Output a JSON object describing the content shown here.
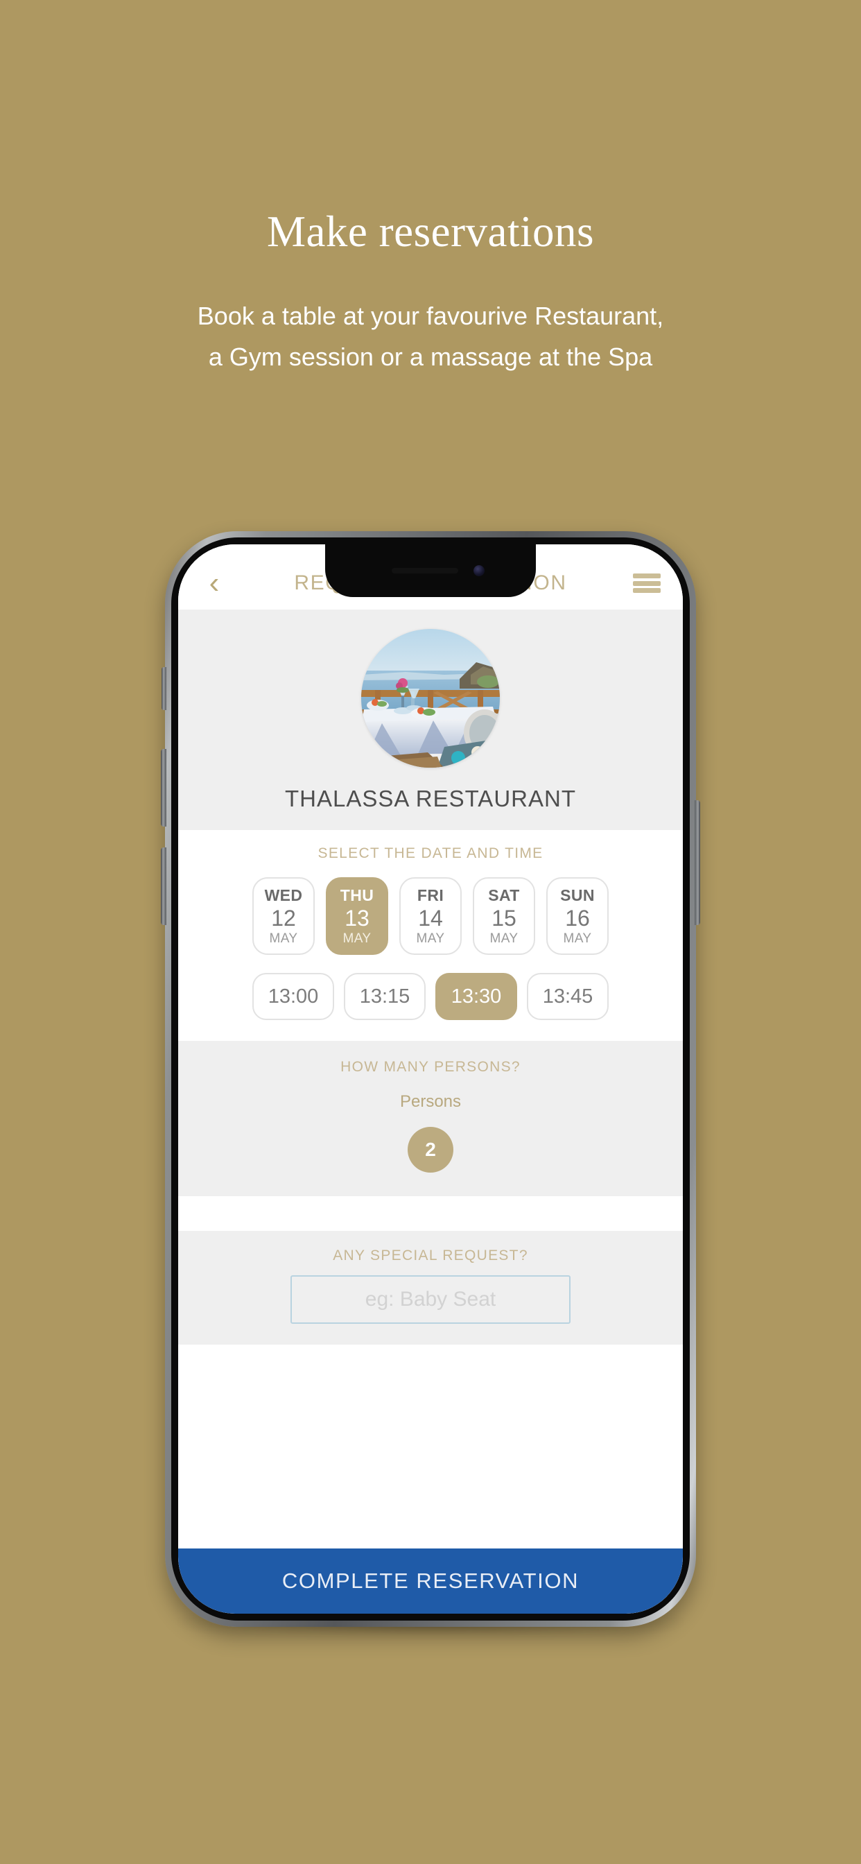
{
  "promo": {
    "title": "Make reservations",
    "subtitle_line1": "Book a table at your favourive Restaurant,",
    "subtitle_line2": "a Gym session or a massage at the Spa"
  },
  "colors": {
    "page_background": "#ae9861",
    "accent_gold": "#bcab80",
    "header_text": "#c3b48d",
    "cta_blue": "#1f5ba8",
    "section_gray": "#efefef",
    "input_border": "#b9d3e0"
  },
  "app": {
    "header": {
      "back_icon": "chevron-left-icon",
      "back_label": "‹",
      "title": "REQUEST RESERVATION",
      "menu_icon": "hamburger-menu-icon"
    },
    "hero": {
      "image_alt": "seaside-restaurant-table-photo",
      "venue_name": "THALASSA RESTAURANT"
    },
    "date_time": {
      "label": "SELECT THE DATE AND TIME",
      "dates": [
        {
          "dow": "WED",
          "day": "12",
          "month": "MAY",
          "selected": false
        },
        {
          "dow": "THU",
          "day": "13",
          "month": "MAY",
          "selected": true
        },
        {
          "dow": "FRI",
          "day": "14",
          "month": "MAY",
          "selected": false
        },
        {
          "dow": "SAT",
          "day": "15",
          "month": "MAY",
          "selected": false
        },
        {
          "dow": "SUN",
          "day": "16",
          "month": "MAY",
          "selected": false
        }
      ],
      "times": [
        {
          "time": "13:00",
          "selected": false
        },
        {
          "time": "13:15",
          "selected": false
        },
        {
          "time": "13:30",
          "selected": true
        },
        {
          "time": "13:45",
          "selected": false
        }
      ]
    },
    "persons": {
      "label": "HOW MANY PERSONS?",
      "field_label": "Persons",
      "value": "2"
    },
    "special_request": {
      "label": "ANY SPECIAL REQUEST?",
      "placeholder": "eg: Baby Seat",
      "value": ""
    },
    "cta": {
      "label": "COMPLETE RESERVATION"
    }
  }
}
